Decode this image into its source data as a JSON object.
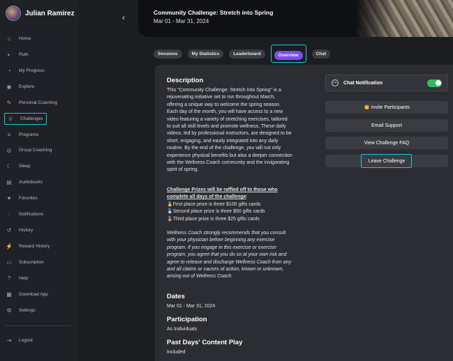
{
  "user": {
    "name": "Julian Ramirez"
  },
  "nav": [
    {
      "label": "Home",
      "icon": "home-icon",
      "glyph": "⌂"
    },
    {
      "label": "Ruth",
      "icon": "ruth-icon",
      "glyph": "◐"
    },
    {
      "label": "My Progress",
      "icon": "progress-icon",
      "glyph": "◔"
    },
    {
      "label": "Explore",
      "icon": "compass-icon",
      "glyph": "◉"
    },
    {
      "label": "Personal Coaching",
      "icon": "coaching-icon",
      "glyph": "✎"
    },
    {
      "label": "Challenges",
      "icon": "trophy-icon",
      "glyph": "♕"
    },
    {
      "label": "Programs",
      "icon": "programs-icon",
      "glyph": "≡"
    },
    {
      "label": "Group Coaching",
      "icon": "broadcast-icon",
      "glyph": "◎"
    },
    {
      "label": "Sleep",
      "icon": "moon-icon",
      "glyph": "☾"
    },
    {
      "label": "Audiobooks",
      "icon": "book-icon",
      "glyph": "▤"
    },
    {
      "label": "Favorites",
      "icon": "heart-icon",
      "glyph": "♥"
    },
    {
      "label": "Notifications",
      "icon": "bell-icon",
      "glyph": "◌"
    },
    {
      "label": "History",
      "icon": "history-icon",
      "glyph": "↺"
    },
    {
      "label": "Reward History",
      "icon": "bolt-icon",
      "glyph": "⚡"
    },
    {
      "label": "Subscription",
      "icon": "card-icon",
      "glyph": "▭"
    },
    {
      "label": "Help",
      "icon": "help-icon",
      "glyph": "?"
    },
    {
      "label": "Download App",
      "icon": "qr-icon",
      "glyph": "▦"
    },
    {
      "label": "Settings",
      "icon": "settings-icon",
      "glyph": "⚙"
    }
  ],
  "logout": {
    "label": "Logout",
    "icon": "logout-icon",
    "glyph": "⇥"
  },
  "banner": {
    "title": "Community Challenge: Stretch into Spring",
    "dates": "Mar 01 - Mar 31, 2024"
  },
  "tabs": [
    "Sessions",
    "My Statistics",
    "Leaderboard",
    "Overview",
    "Chat"
  ],
  "active_tab": "Overview",
  "content": {
    "description_heading": "Description",
    "description": "This \"Community Challenge: Stretch Into Spring\" is a rejuvenating initiative set to run throughout March, offering a unique way to welcome the spring season. Each day of the month, you will have access to a new video featuring a variety of stretching exercises, tailored to suit all skill levels and promote wellness. These daily videos, led by professional instructors, are designed to be short, engaging, and easily integrated into any daily routine. By the end of the challenge, you will not only experience physical benefits but also a deeper connection with the Wellness Coach community and the invigorating spirit of spring.",
    "prizes_heading": "Challenge Prizes will be raffled off to those who complete all days of the challenge",
    "prizes_colon": ":",
    "prizes": [
      "🥇First place prize is three $100 gifts cards",
      "🥈Second place prize is three $50 gifts cards",
      "🥉Third place prize is three $25 gifts cards"
    ],
    "disclaimer": "Wellness Coach strongly recommends that you consult with your physician before beginning any exercise program. If you engage in this exercise or exercise program, you agree that you do so at your own risk and agree to release and discharge Wellness Coach from any and all claims or causes of action, known or unknown, arising out of Wellness Coach.",
    "dates_heading": "Dates",
    "dates_value": "Mar 01 - Mar 31, 2024",
    "participation_heading": "Participation",
    "participation_value": "As Individuals",
    "past_heading": "Past Days' Content Play",
    "past_value": "Included"
  },
  "side": {
    "chat_notification": "Chat Notification",
    "chat_notification_on": true,
    "invite": "👏 Invite Participants",
    "email": "Email Support",
    "faq": "View Challenge FAQ",
    "leave": "Leave Challenge"
  },
  "colors": {
    "accent": "#7a4cf3",
    "highlight": "#19c8d8",
    "toggle_on": "#2fbf5a"
  }
}
